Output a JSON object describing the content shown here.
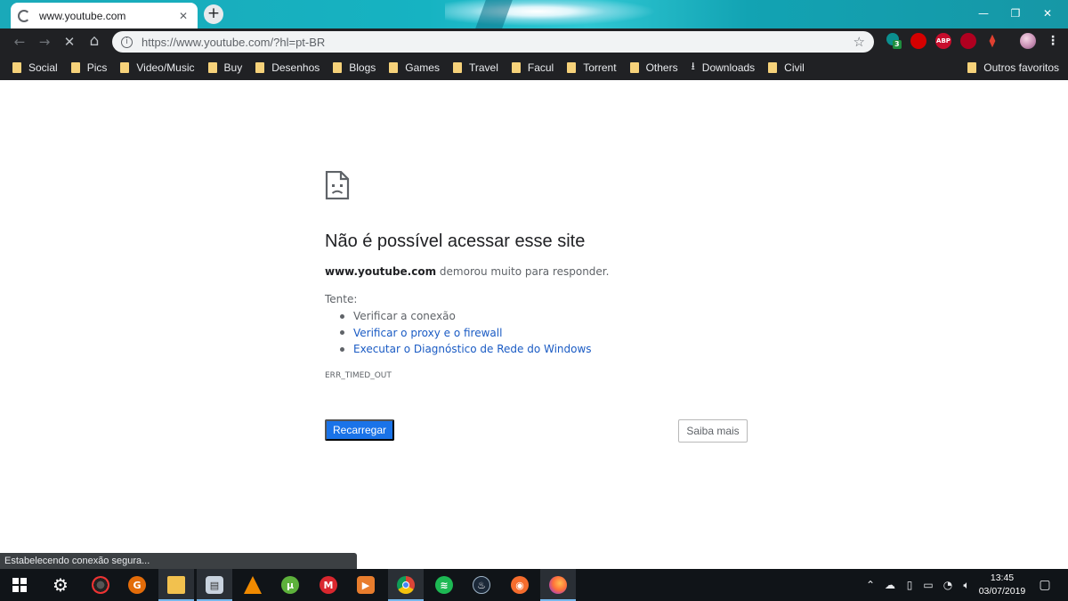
{
  "tab": {
    "title": "www.youtube.com",
    "close_glyph": "✕"
  },
  "newtab_glyph": "+",
  "window_controls": {
    "minimize": "—",
    "maximize": "❐",
    "close": "✕"
  },
  "toolbar": {
    "back_glyph": "←",
    "forward_glyph": "→",
    "stop_glyph": "✕",
    "home_glyph": "⌂",
    "url": "https://www.youtube.com/?hl=pt-BR",
    "star_glyph": "☆",
    "extensions": [
      {
        "icon": "badge-counter-icon",
        "label": "3",
        "color": "#1e8e3e"
      },
      {
        "icon": "red-shield-icon",
        "label": "",
        "color": "#d50000"
      },
      {
        "icon": "adblock-plus-icon",
        "label": "ABP",
        "color": "#c70d2c"
      },
      {
        "icon": "ublock-icon",
        "label": "",
        "color": "#b00020"
      },
      {
        "icon": "acrobat-icon",
        "label": "",
        "color": "#a41e11"
      }
    ]
  },
  "bookmarks": {
    "items": [
      {
        "label": "Social",
        "icon": "folder-icon"
      },
      {
        "label": "Pics",
        "icon": "folder-icon"
      },
      {
        "label": "Video/Music",
        "icon": "folder-icon"
      },
      {
        "label": "Buy",
        "icon": "folder-icon"
      },
      {
        "label": "Desenhos",
        "icon": "folder-icon"
      },
      {
        "label": "Blogs",
        "icon": "folder-icon"
      },
      {
        "label": "Games",
        "icon": "folder-icon"
      },
      {
        "label": "Travel",
        "icon": "folder-icon"
      },
      {
        "label": "Facul",
        "icon": "folder-icon"
      },
      {
        "label": "Torrent",
        "icon": "folder-icon"
      },
      {
        "label": "Others",
        "icon": "folder-icon"
      },
      {
        "label": "Downloads",
        "icon": "download-icon"
      },
      {
        "label": "Civil",
        "icon": "folder-icon"
      }
    ],
    "other": "Outros favoritos"
  },
  "error_page": {
    "title": "Não é possível acessar esse site",
    "host": "www.youtube.com",
    "description": " demorou muito para responder.",
    "try_label": "Tente:",
    "suggestions": [
      "Verificar a conexão",
      "Verificar o proxy e o firewall",
      "Executar o Diagnóstico de Rede do Windows"
    ],
    "error_code": "ERR_TIMED_OUT",
    "reload_label": "Recarregar",
    "learn_more_label": "Saiba mais"
  },
  "status_text": "Estabelecendo conexão segura...",
  "taskbar": {
    "apps": [
      {
        "icon": "windows-start-icon"
      },
      {
        "icon": "settings-gear-icon"
      },
      {
        "icon": "obs-icon"
      },
      {
        "icon": "gimp-icon"
      },
      {
        "icon": "file-explorer-icon"
      },
      {
        "icon": "video-editor-icon"
      },
      {
        "icon": "vlc-icon"
      },
      {
        "icon": "utorrent-icon"
      },
      {
        "icon": "mega-icon"
      },
      {
        "icon": "media-player-icon"
      },
      {
        "icon": "chrome-icon"
      },
      {
        "icon": "spotify-icon"
      },
      {
        "icon": "steam-icon"
      },
      {
        "icon": "origin-icon"
      },
      {
        "icon": "firefox-icon"
      }
    ],
    "clock_time": "13:45",
    "clock_date": "03/07/2019"
  },
  "colors": {
    "accent_blue": "#1a73e8",
    "link_blue": "#1a5bc4",
    "chrome_dark": "#202124",
    "tab_strip_teal": "#16b3c2"
  }
}
